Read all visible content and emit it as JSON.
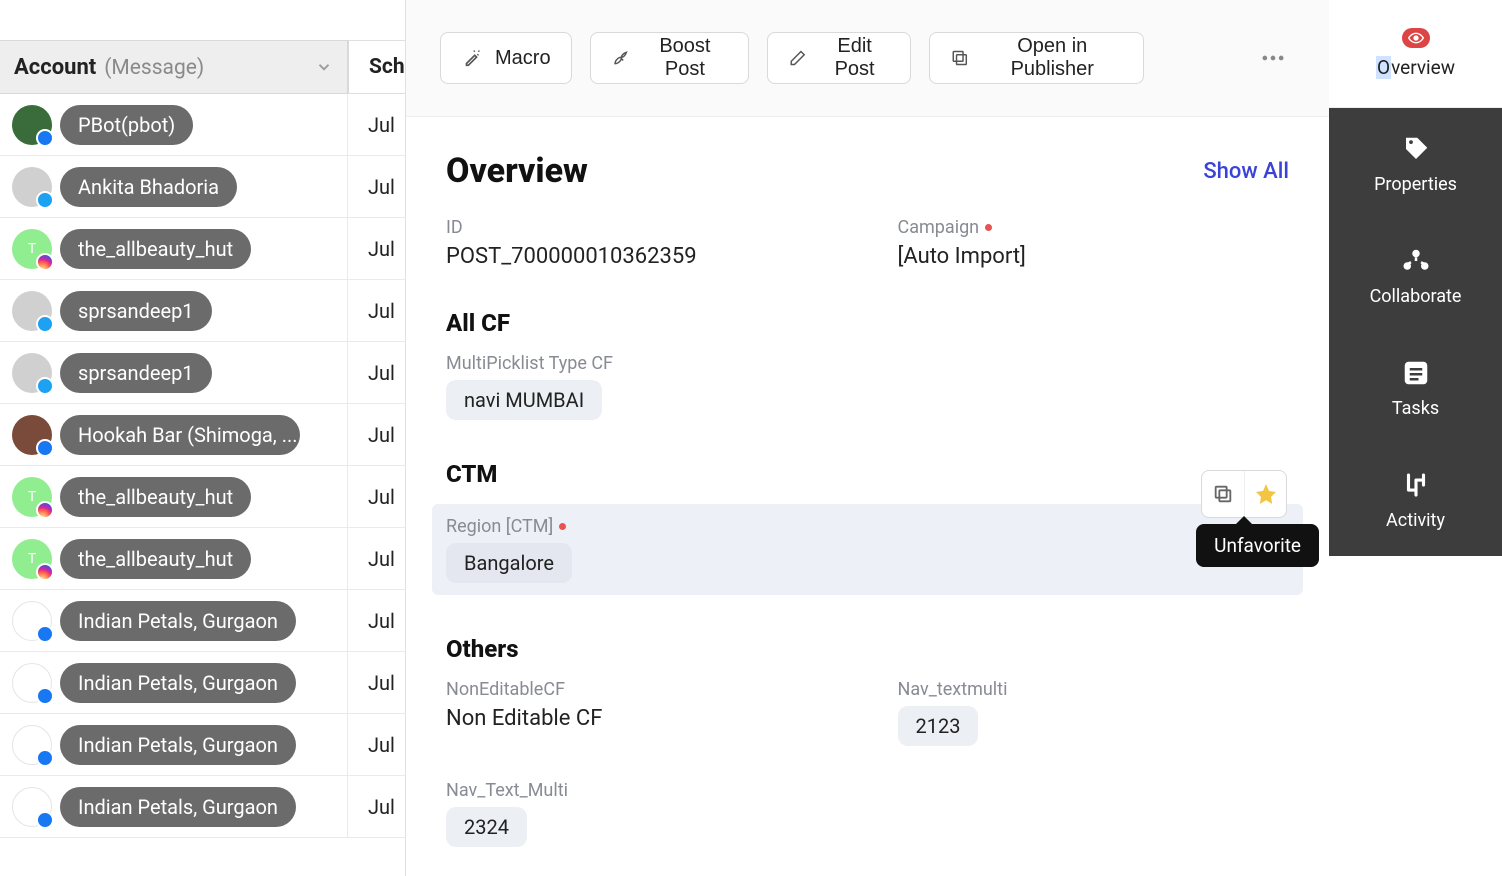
{
  "leftPanel": {
    "header": {
      "label": "Account",
      "sub": "(Message)"
    },
    "schHeader": "Sch",
    "rows": [
      {
        "name": "PBot(pbot)",
        "avatarClass": "img1",
        "social": "fb",
        "date": "Jul"
      },
      {
        "name": "Ankita Bhadoria",
        "avatarClass": "gray",
        "social": "tw",
        "date": "Jul"
      },
      {
        "name": "the_allbeauty_hut",
        "avatarClass": "gray",
        "social": "ig",
        "avatarLetter": "T",
        "avatarBg": "#90ee90",
        "date": "Jul"
      },
      {
        "name": "sprsandeep1",
        "avatarClass": "gray",
        "social": "tw",
        "date": "Jul"
      },
      {
        "name": "sprsandeep1",
        "avatarClass": "gray",
        "social": "tw",
        "date": "Jul"
      },
      {
        "name": "Hookah Bar (Shimoga, ...",
        "avatarClass": "img2",
        "social": "fb",
        "date": "Jul"
      },
      {
        "name": "the_allbeauty_hut",
        "avatarClass": "gray",
        "social": "ig",
        "avatarLetter": "T",
        "avatarBg": "#90ee90",
        "date": "Jul"
      },
      {
        "name": "the_allbeauty_hut",
        "avatarClass": "gray",
        "social": "ig",
        "avatarLetter": "T",
        "avatarBg": "#90ee90",
        "date": "Jul"
      },
      {
        "name": "Indian Petals, Gurgaon",
        "avatarClass": "white",
        "social": "fb",
        "date": "Jul"
      },
      {
        "name": "Indian Petals, Gurgaon",
        "avatarClass": "white",
        "social": "fb",
        "date": "Jul"
      },
      {
        "name": "Indian Petals, Gurgaon",
        "avatarClass": "white",
        "social": "fb",
        "date": "Jul"
      },
      {
        "name": "Indian Petals, Gurgaon",
        "avatarClass": "white",
        "social": "fb",
        "date": "Jul"
      }
    ]
  },
  "toolbar": {
    "macro": "Macro",
    "boost": "Boost Post",
    "edit": "Edit Post",
    "open": "Open in Publisher"
  },
  "overview": {
    "title": "Overview",
    "showAll": "Show All",
    "idLabel": "ID",
    "idValue": "POST_700000010362359",
    "campaignLabel": "Campaign",
    "campaignValue": "[Auto Import]",
    "allCfTitle": "All CF",
    "multiPickLabel": "MultiPicklist Type CF",
    "multiPickValue": "navi MUMBAI",
    "ctmTitle": "CTM",
    "regionLabel": "Region [CTM]",
    "regionValue": "Bangalore",
    "tooltip": "Unfavorite",
    "othersTitle": "Others",
    "nonEditLabel": "NonEditableCF",
    "nonEditValue": "Non Editable CF",
    "navTextMultiALabel": "Nav_textmulti",
    "navTextMultiAValue": "2123",
    "navTextMultiBLabel": "Nav_Text_Multi",
    "navTextMultiBValue": "2324"
  },
  "rightRail": {
    "overview": "Overview",
    "properties": "Properties",
    "collaborate": "Collaborate",
    "tasks": "Tasks",
    "activity": "Activity"
  }
}
